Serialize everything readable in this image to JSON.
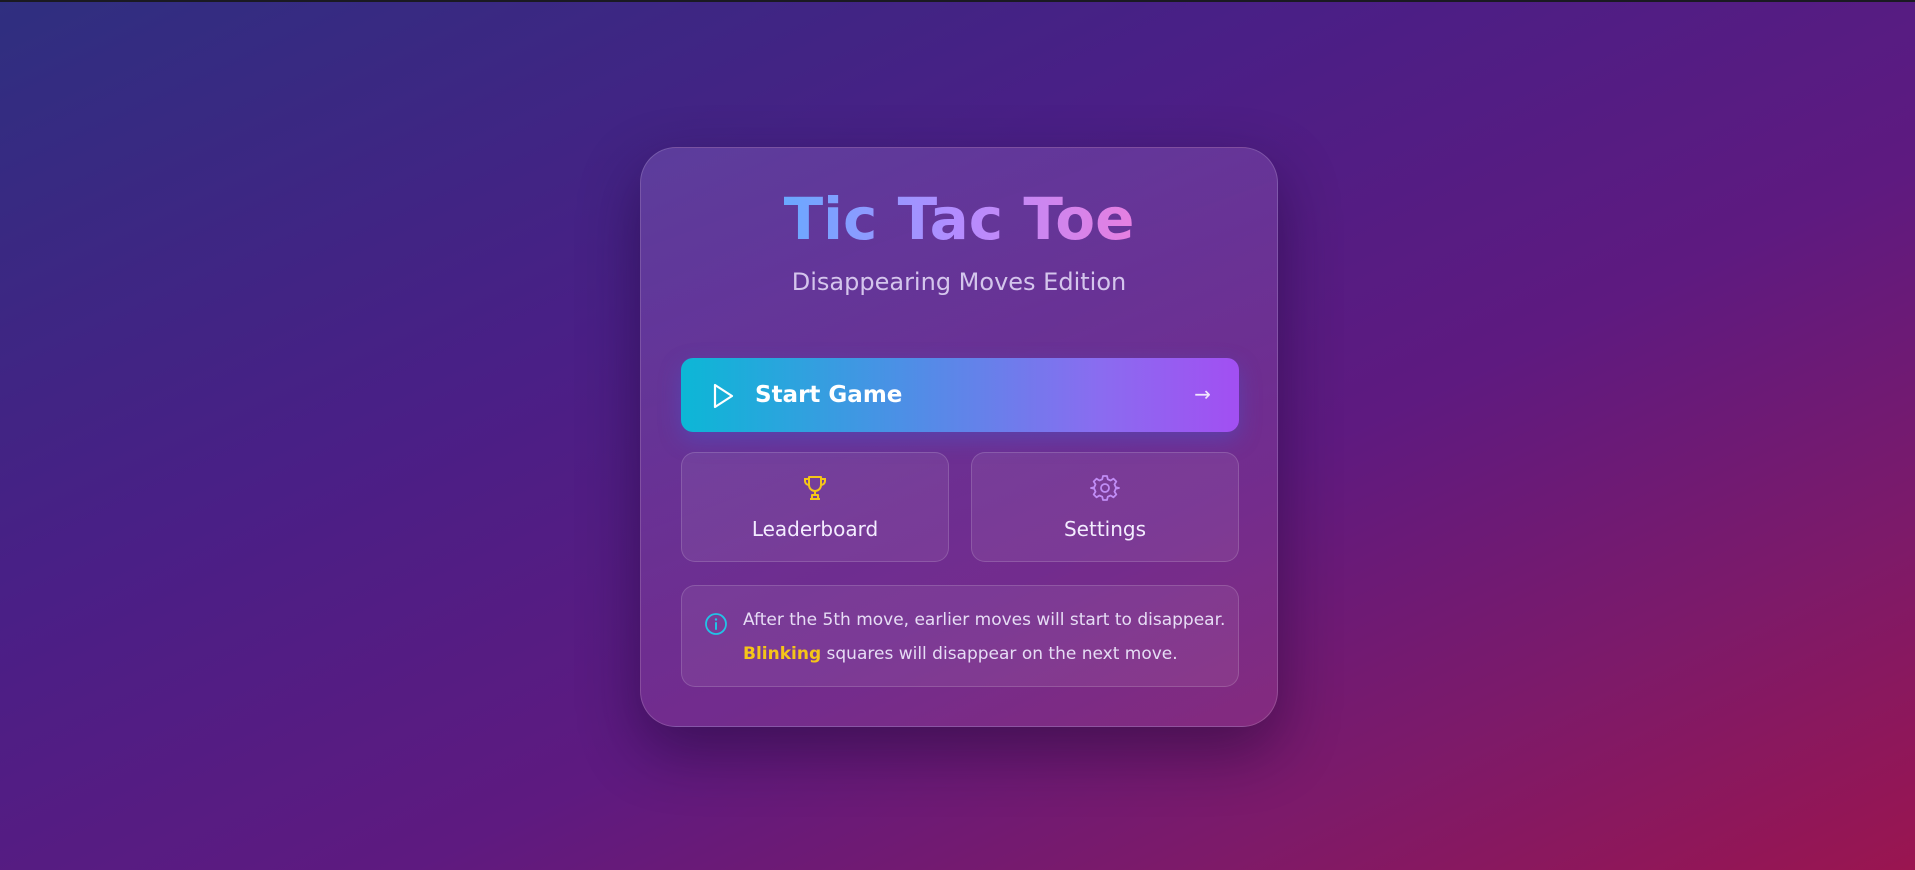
{
  "app": {
    "title": "Tic Tac Toe",
    "subtitle": "Disappearing Moves Edition"
  },
  "start_button": {
    "label": "Start Game",
    "icon": "play-icon",
    "trailing_arrow": "→",
    "gradient": [
      "#0cb7d6",
      "#a24ff2"
    ]
  },
  "tiles": [
    {
      "label": "Leaderboard",
      "icon": "trophy-icon",
      "icon_color": "#f5c518"
    },
    {
      "label": "Settings",
      "icon": "gear-icon",
      "icon_color": "#c08cf5"
    }
  ],
  "info": {
    "icon": "info-icon",
    "icon_color": "#22c3e6",
    "line1": "After the 5th move, earlier moves will start to disappear.",
    "highlight": "Blinking",
    "highlight_color": "#f5c518",
    "line2_rest": " squares will disappear on the next move."
  }
}
